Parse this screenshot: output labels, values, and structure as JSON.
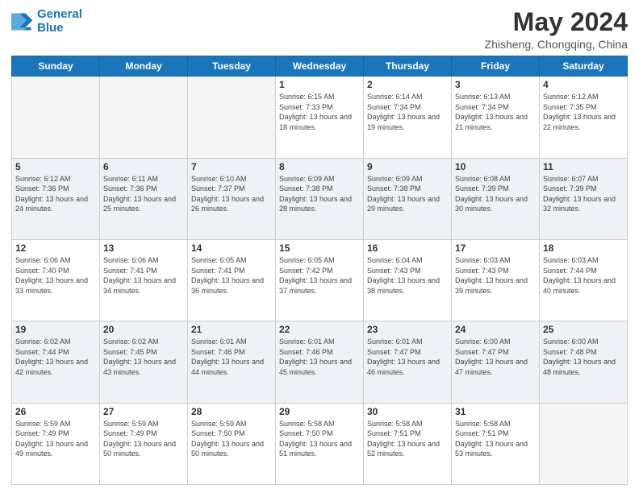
{
  "header": {
    "logo_line1": "General",
    "logo_line2": "Blue",
    "month_year": "May 2024",
    "location": "Zhisheng, Chongqing, China"
  },
  "days_of_week": [
    "Sunday",
    "Monday",
    "Tuesday",
    "Wednesday",
    "Thursday",
    "Friday",
    "Saturday"
  ],
  "weeks": [
    [
      {
        "day": "",
        "sunrise": "",
        "sunset": "",
        "daylight": "",
        "empty": true
      },
      {
        "day": "",
        "sunrise": "",
        "sunset": "",
        "daylight": "",
        "empty": true
      },
      {
        "day": "",
        "sunrise": "",
        "sunset": "",
        "daylight": "",
        "empty": true
      },
      {
        "day": "1",
        "sunrise": "Sunrise: 6:15 AM",
        "sunset": "Sunset: 7:33 PM",
        "daylight": "Daylight: 13 hours and 18 minutes."
      },
      {
        "day": "2",
        "sunrise": "Sunrise: 6:14 AM",
        "sunset": "Sunset: 7:34 PM",
        "daylight": "Daylight: 13 hours and 19 minutes."
      },
      {
        "day": "3",
        "sunrise": "Sunrise: 6:13 AM",
        "sunset": "Sunset: 7:34 PM",
        "daylight": "Daylight: 13 hours and 21 minutes."
      },
      {
        "day": "4",
        "sunrise": "Sunrise: 6:12 AM",
        "sunset": "Sunset: 7:35 PM",
        "daylight": "Daylight: 13 hours and 22 minutes."
      }
    ],
    [
      {
        "day": "5",
        "sunrise": "Sunrise: 6:12 AM",
        "sunset": "Sunset: 7:36 PM",
        "daylight": "Daylight: 13 hours and 24 minutes."
      },
      {
        "day": "6",
        "sunrise": "Sunrise: 6:11 AM",
        "sunset": "Sunset: 7:36 PM",
        "daylight": "Daylight: 13 hours and 25 minutes."
      },
      {
        "day": "7",
        "sunrise": "Sunrise: 6:10 AM",
        "sunset": "Sunset: 7:37 PM",
        "daylight": "Daylight: 13 hours and 26 minutes."
      },
      {
        "day": "8",
        "sunrise": "Sunrise: 6:09 AM",
        "sunset": "Sunset: 7:38 PM",
        "daylight": "Daylight: 13 hours and 28 minutes."
      },
      {
        "day": "9",
        "sunrise": "Sunrise: 6:09 AM",
        "sunset": "Sunset: 7:38 PM",
        "daylight": "Daylight: 13 hours and 29 minutes."
      },
      {
        "day": "10",
        "sunrise": "Sunrise: 6:08 AM",
        "sunset": "Sunset: 7:39 PM",
        "daylight": "Daylight: 13 hours and 30 minutes."
      },
      {
        "day": "11",
        "sunrise": "Sunrise: 6:07 AM",
        "sunset": "Sunset: 7:39 PM",
        "daylight": "Daylight: 13 hours and 32 minutes."
      }
    ],
    [
      {
        "day": "12",
        "sunrise": "Sunrise: 6:06 AM",
        "sunset": "Sunset: 7:40 PM",
        "daylight": "Daylight: 13 hours and 33 minutes."
      },
      {
        "day": "13",
        "sunrise": "Sunrise: 6:06 AM",
        "sunset": "Sunset: 7:41 PM",
        "daylight": "Daylight: 13 hours and 34 minutes."
      },
      {
        "day": "14",
        "sunrise": "Sunrise: 6:05 AM",
        "sunset": "Sunset: 7:41 PM",
        "daylight": "Daylight: 13 hours and 36 minutes."
      },
      {
        "day": "15",
        "sunrise": "Sunrise: 6:05 AM",
        "sunset": "Sunset: 7:42 PM",
        "daylight": "Daylight: 13 hours and 37 minutes."
      },
      {
        "day": "16",
        "sunrise": "Sunrise: 6:04 AM",
        "sunset": "Sunset: 7:43 PM",
        "daylight": "Daylight: 13 hours and 38 minutes."
      },
      {
        "day": "17",
        "sunrise": "Sunrise: 6:03 AM",
        "sunset": "Sunset: 7:43 PM",
        "daylight": "Daylight: 13 hours and 39 minutes."
      },
      {
        "day": "18",
        "sunrise": "Sunrise: 6:03 AM",
        "sunset": "Sunset: 7:44 PM",
        "daylight": "Daylight: 13 hours and 40 minutes."
      }
    ],
    [
      {
        "day": "19",
        "sunrise": "Sunrise: 6:02 AM",
        "sunset": "Sunset: 7:44 PM",
        "daylight": "Daylight: 13 hours and 42 minutes."
      },
      {
        "day": "20",
        "sunrise": "Sunrise: 6:02 AM",
        "sunset": "Sunset: 7:45 PM",
        "daylight": "Daylight: 13 hours and 43 minutes."
      },
      {
        "day": "21",
        "sunrise": "Sunrise: 6:01 AM",
        "sunset": "Sunset: 7:46 PM",
        "daylight": "Daylight: 13 hours and 44 minutes."
      },
      {
        "day": "22",
        "sunrise": "Sunrise: 6:01 AM",
        "sunset": "Sunset: 7:46 PM",
        "daylight": "Daylight: 13 hours and 45 minutes."
      },
      {
        "day": "23",
        "sunrise": "Sunrise: 6:01 AM",
        "sunset": "Sunset: 7:47 PM",
        "daylight": "Daylight: 13 hours and 46 minutes."
      },
      {
        "day": "24",
        "sunrise": "Sunrise: 6:00 AM",
        "sunset": "Sunset: 7:47 PM",
        "daylight": "Daylight: 13 hours and 47 minutes."
      },
      {
        "day": "25",
        "sunrise": "Sunrise: 6:00 AM",
        "sunset": "Sunset: 7:48 PM",
        "daylight": "Daylight: 13 hours and 48 minutes."
      }
    ],
    [
      {
        "day": "26",
        "sunrise": "Sunrise: 5:59 AM",
        "sunset": "Sunset: 7:49 PM",
        "daylight": "Daylight: 13 hours and 49 minutes."
      },
      {
        "day": "27",
        "sunrise": "Sunrise: 5:59 AM",
        "sunset": "Sunset: 7:49 PM",
        "daylight": "Daylight: 13 hours and 50 minutes."
      },
      {
        "day": "28",
        "sunrise": "Sunrise: 5:59 AM",
        "sunset": "Sunset: 7:50 PM",
        "daylight": "Daylight: 13 hours and 50 minutes."
      },
      {
        "day": "29",
        "sunrise": "Sunrise: 5:58 AM",
        "sunset": "Sunset: 7:50 PM",
        "daylight": "Daylight: 13 hours and 51 minutes."
      },
      {
        "day": "30",
        "sunrise": "Sunrise: 5:58 AM",
        "sunset": "Sunset: 7:51 PM",
        "daylight": "Daylight: 13 hours and 52 minutes."
      },
      {
        "day": "31",
        "sunrise": "Sunrise: 5:58 AM",
        "sunset": "Sunset: 7:51 PM",
        "daylight": "Daylight: 13 hours and 53 minutes."
      },
      {
        "day": "",
        "sunrise": "",
        "sunset": "",
        "daylight": "",
        "empty": true
      }
    ]
  ]
}
